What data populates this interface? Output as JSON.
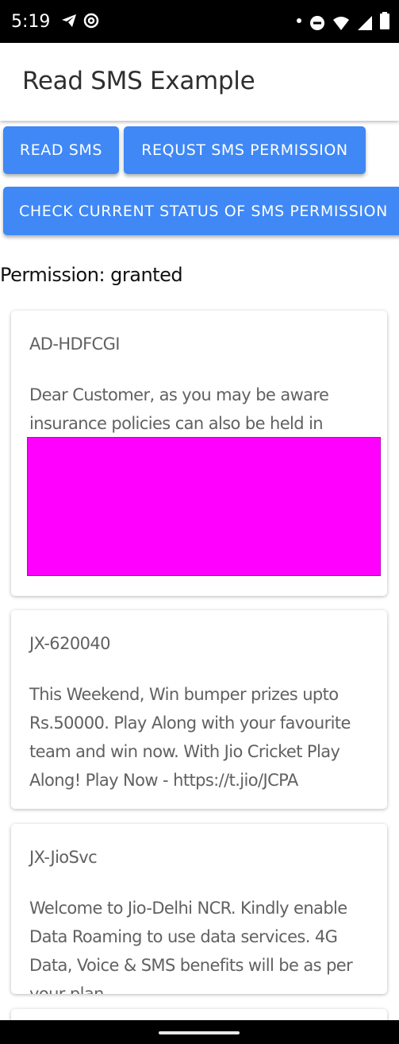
{
  "status_bar": {
    "time": "5:19",
    "left_icons": [
      "telegram-icon",
      "at-sign-icon"
    ],
    "right_icons": [
      "dot-icon",
      "do-not-disturb-icon",
      "wifi-icon",
      "signal-icon",
      "battery-icon"
    ]
  },
  "app_bar": {
    "title": "Read SMS Example"
  },
  "buttons": {
    "read_sms": "READ SMS",
    "request_permission": "REQUST SMS PERMISSION",
    "check_status": "CHECK CURRENT STATUS OF SMS PERMISSION"
  },
  "permission_text": "Permission: granted",
  "messages": [
    {
      "sender": "AD-HDFCGI",
      "body": "Dear Customer, as you may be aware insurance policies can also be held in electronic form in an"
    },
    {
      "sender": "JX-620040",
      "body": "This Weekend, Win bumper prizes upto Rs.50000. Play Along with your favourite team and win now. With Jio Cricket Play Along! Play Now - https://t.jio/JCPA"
    },
    {
      "sender": "JX-JioSvc",
      "body": "Welcome to Jio-Delhi NCR. Kindly enable Data Roaming to use data services. 4G Data, Voice & SMS benefits will be as per your plan."
    }
  ],
  "colors": {
    "accent": "#3f88f6",
    "redaction": "#ff00ff",
    "status_bar": "#000000"
  }
}
